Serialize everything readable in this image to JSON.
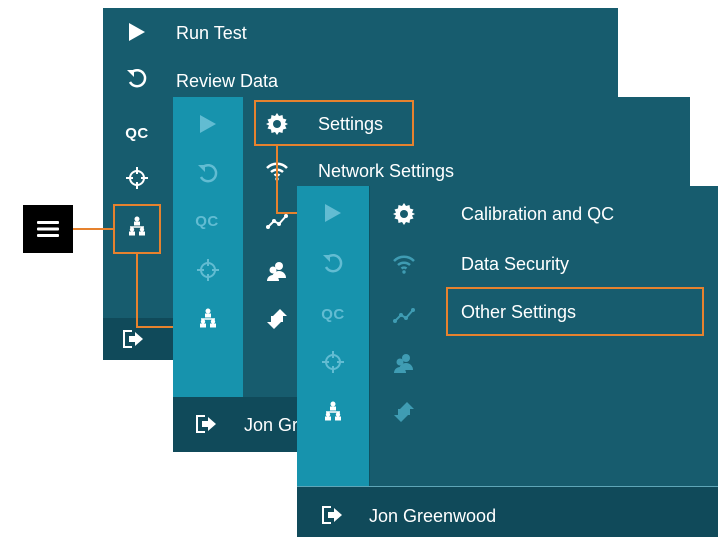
{
  "menu_button": {
    "icon": "hamburger-menu-icon"
  },
  "main_menu": {
    "items": [
      {
        "label": "Run Test",
        "icon": "play-icon"
      },
      {
        "label": "Review Data",
        "icon": "undo-arrow-icon"
      },
      {
        "label": "",
        "icon": "qc-icon",
        "icon_text": "QC"
      },
      {
        "label": "",
        "icon": "crosshair-icon"
      },
      {
        "label": "",
        "icon": "org-chart-icon"
      }
    ],
    "footer_icon": "logout-icon"
  },
  "settings_menu": {
    "items": [
      {
        "label": "Settings",
        "icon": "gear-icon"
      },
      {
        "label": "Network Settings",
        "icon": "wifi-icon"
      }
    ],
    "footer_user": "Jon Gr"
  },
  "settings_submenu": {
    "items": [
      {
        "label": "Calibration and QC",
        "icon": "gear-icon"
      },
      {
        "label": "Data Security",
        "icon": "wifi-icon"
      },
      {
        "label": "Other Settings",
        "icon": "trend-icon"
      }
    ],
    "footer_user": "Jon Greenwood"
  },
  "rail": {
    "qc_text": "QC"
  },
  "colors": {
    "panel": "#175c6e",
    "rail": "#1793ad",
    "footer": "#104a5a",
    "highlight": "#e6822e",
    "menu_button": "#000000"
  }
}
